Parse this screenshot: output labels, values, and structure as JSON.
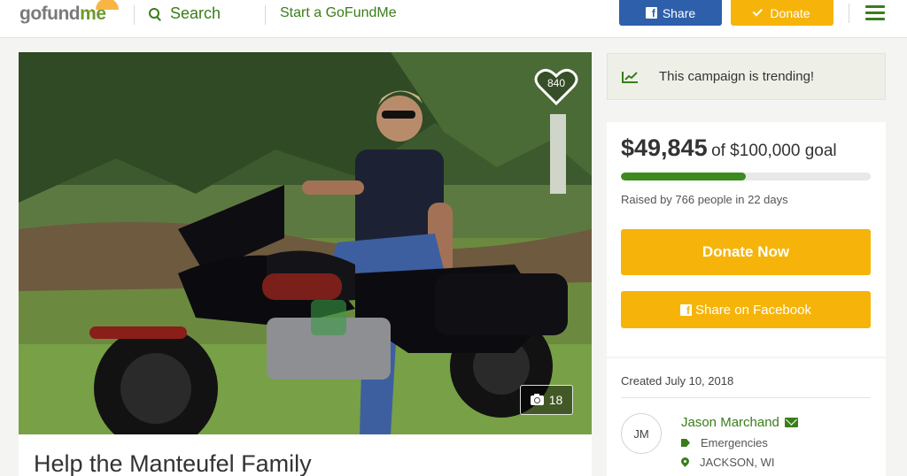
{
  "header": {
    "logo_main": "gofund",
    "logo_accent": "me",
    "search_label": "Search",
    "start_label": "Start a GoFundMe",
    "share_label": "Share",
    "donate_label": "Donate",
    "menu_icon": "hamburger-icon"
  },
  "campaign": {
    "photo_alt_icons": [
      "heart-icon",
      "camera-icon"
    ],
    "heart_count": "840",
    "photo_count": "18",
    "title": "Help the Manteufel Family"
  },
  "sidebar": {
    "trending_icon": "trend-chart-icon",
    "trending_text": "This campaign is trending!",
    "raised_amount": "$49,845",
    "goal_text": "of $100,000 goal",
    "progress_fraction": 0.49845,
    "raised_summary": "Raised by 766 people in 22 days",
    "donate_now_label": "Donate Now",
    "share_fb_label": "Share on Facebook",
    "created": "Created July 10, 2018",
    "organizer_initials": "JM",
    "organizer_name": "Jason Marchand",
    "category": "Emergencies",
    "location": "JACKSON, WI"
  },
  "colors": {
    "brand_green": "#3a7d1a",
    "donate_orange": "#f6b40a",
    "facebook_blue": "#2e5faa",
    "progress_green": "#3b8b1e"
  }
}
